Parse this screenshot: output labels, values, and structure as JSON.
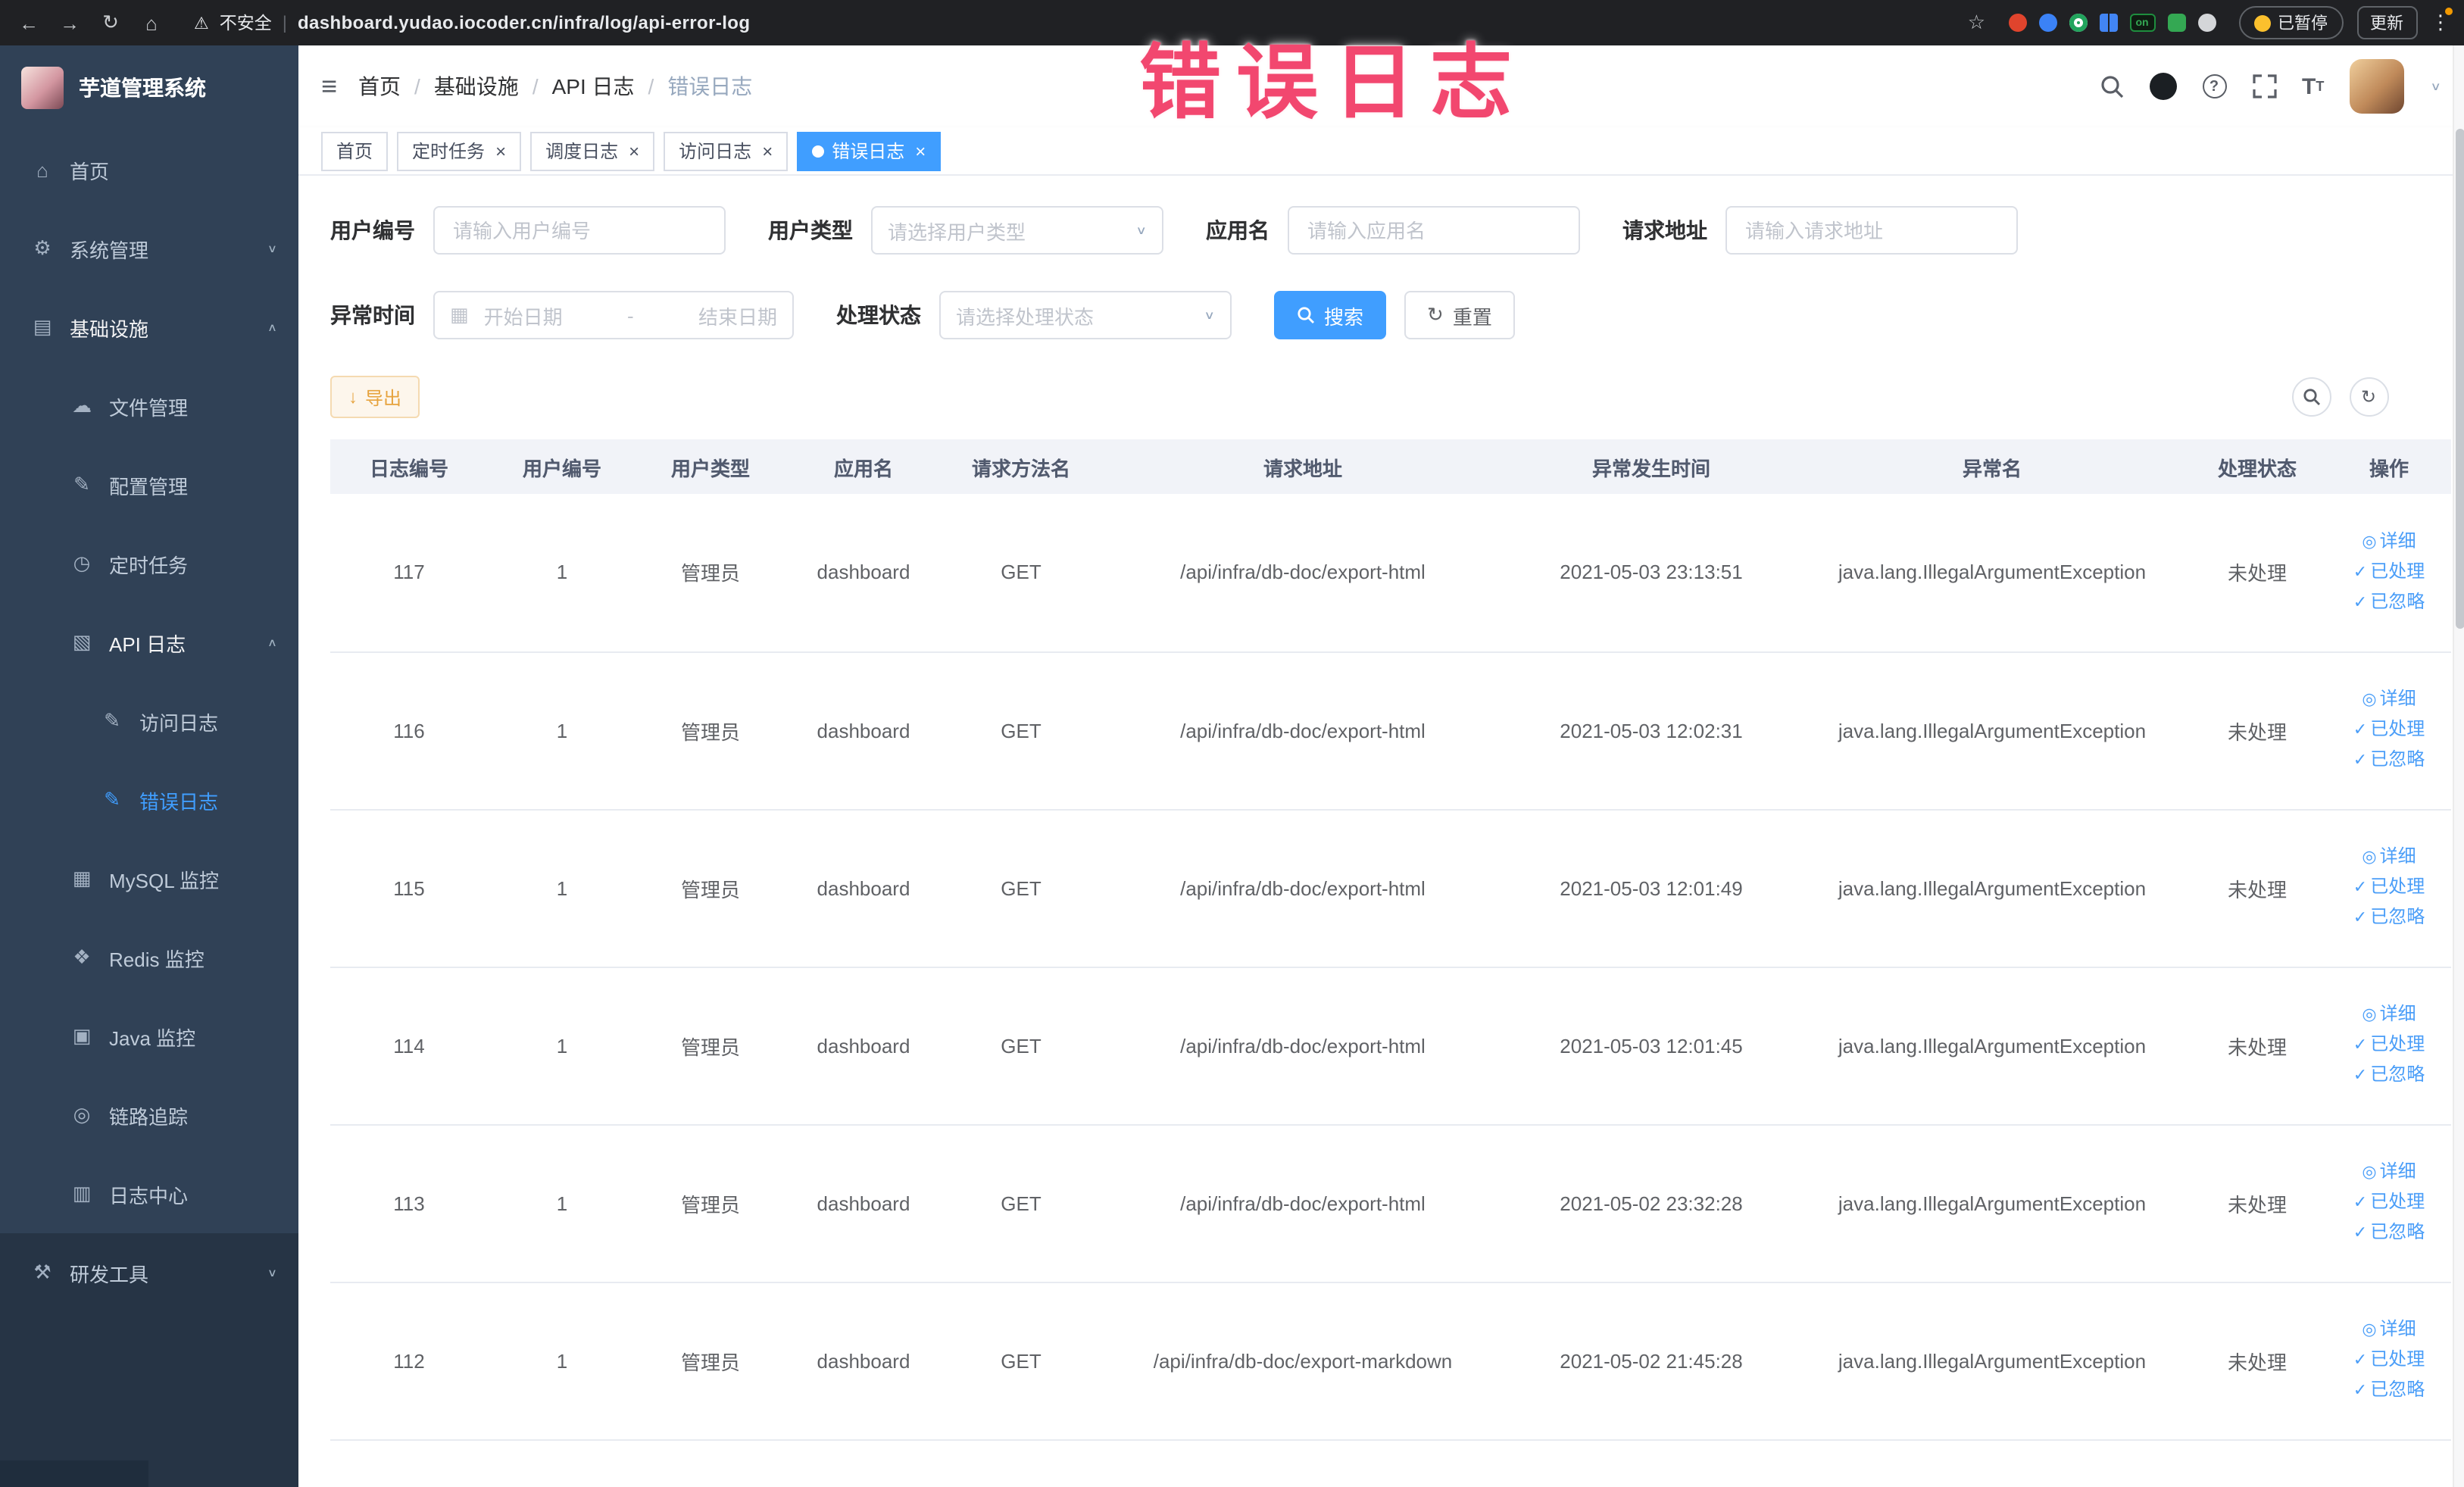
{
  "theme": {
    "accent": "#409eff",
    "sidebar_bg": "#304156",
    "warning": "#e6a23c",
    "annotation_color": "#f2476f"
  },
  "browser": {
    "security_label": "不安全",
    "url": "dashboard.yudao.iocoder.cn/infra/log/api-error-log",
    "paused_badge": "已暂停",
    "update_button": "更新",
    "on_badge": "on"
  },
  "annotation": {
    "text": "错误日志"
  },
  "sidebar": {
    "logo": "芋道管理系统",
    "items": [
      {
        "label": "首页",
        "icon": "⌂"
      },
      {
        "label": "系统管理",
        "icon": "⚙",
        "arrow": "∨"
      },
      {
        "label": "基础设施",
        "icon": "▤",
        "arrow": "∧"
      },
      {
        "label": "文件管理",
        "icon": "☁"
      },
      {
        "label": "配置管理",
        "icon": "✎"
      },
      {
        "label": "定时任务",
        "icon": "◷"
      },
      {
        "label": "API 日志",
        "icon": "▧",
        "arrow": "∧"
      },
      {
        "label": "访问日志",
        "icon": "✎"
      },
      {
        "label": "错误日志",
        "icon": "✎"
      },
      {
        "label": "MySQL 监控",
        "icon": "▦"
      },
      {
        "label": "Redis 监控",
        "icon": "❖"
      },
      {
        "label": "Java 监控",
        "icon": "▣"
      },
      {
        "label": "链路追踪",
        "icon": "◎"
      },
      {
        "label": "日志中心",
        "icon": "▥"
      },
      {
        "label": "研发工具",
        "icon": "⚒",
        "arrow": "∨"
      }
    ]
  },
  "breadcrumb": {
    "items": [
      "首页",
      "基础设施",
      "API 日志",
      "错误日志"
    ],
    "separator": "/"
  },
  "tabs": [
    {
      "label": "首页"
    },
    {
      "label": "定时任务",
      "close": "×"
    },
    {
      "label": "调度日志",
      "close": "×"
    },
    {
      "label": "访问日志",
      "close": "×"
    },
    {
      "label": "错误日志",
      "close": "×"
    }
  ],
  "filters": {
    "user_id": {
      "label": "用户编号",
      "placeholder": "请输入用户编号"
    },
    "user_type": {
      "label": "用户类型",
      "placeholder": "请选择用户类型"
    },
    "app_name": {
      "label": "应用名",
      "placeholder": "请输入应用名"
    },
    "request_url": {
      "label": "请求地址",
      "placeholder": "请输入请求地址"
    },
    "exception_time": {
      "label": "异常时间",
      "start": "开始日期",
      "separator": "-",
      "end": "结束日期"
    },
    "process_status": {
      "label": "处理状态",
      "placeholder": "请选择处理状态"
    },
    "search": "搜索",
    "reset": "重置"
  },
  "toolbar": {
    "export": "导出"
  },
  "table": {
    "columns": [
      "日志编号",
      "用户编号",
      "用户类型",
      "应用名",
      "请求方法名",
      "请求地址",
      "异常发生时间",
      "异常名",
      "处理状态",
      "操作"
    ],
    "actions": {
      "detail": {
        "icon": "◎",
        "label": "详细"
      },
      "processed": {
        "icon": "✓",
        "label": "已处理"
      },
      "ignored": {
        "icon": "✓",
        "label": "已忽略"
      }
    },
    "rows": [
      {
        "id": "117",
        "user_id": "1",
        "user_type": "管理员",
        "app": "dashboard",
        "method": "GET",
        "url": "/api/infra/db-doc/export-html",
        "time": "2021-05-03 23:13:51",
        "exception": "java.lang.IllegalArgumentException",
        "status": "未处理"
      },
      {
        "id": "116",
        "user_id": "1",
        "user_type": "管理员",
        "app": "dashboard",
        "method": "GET",
        "url": "/api/infra/db-doc/export-html",
        "time": "2021-05-03 12:02:31",
        "exception": "java.lang.IllegalArgumentException",
        "status": "未处理"
      },
      {
        "id": "115",
        "user_id": "1",
        "user_type": "管理员",
        "app": "dashboard",
        "method": "GET",
        "url": "/api/infra/db-doc/export-html",
        "time": "2021-05-03 12:01:49",
        "exception": "java.lang.IllegalArgumentException",
        "status": "未处理"
      },
      {
        "id": "114",
        "user_id": "1",
        "user_type": "管理员",
        "app": "dashboard",
        "method": "GET",
        "url": "/api/infra/db-doc/export-html",
        "time": "2021-05-03 12:01:45",
        "exception": "java.lang.IllegalArgumentException",
        "status": "未处理"
      },
      {
        "id": "113",
        "user_id": "1",
        "user_type": "管理员",
        "app": "dashboard",
        "method": "GET",
        "url": "/api/infra/db-doc/export-html",
        "time": "2021-05-02 23:32:28",
        "exception": "java.lang.IllegalArgumentException",
        "status": "未处理"
      },
      {
        "id": "112",
        "user_id": "1",
        "user_type": "管理员",
        "app": "dashboard",
        "method": "GET",
        "url": "/api/infra/db-doc/export-markdown",
        "time": "2021-05-02 21:45:28",
        "exception": "java.lang.IllegalArgumentException",
        "status": "未处理"
      }
    ]
  }
}
